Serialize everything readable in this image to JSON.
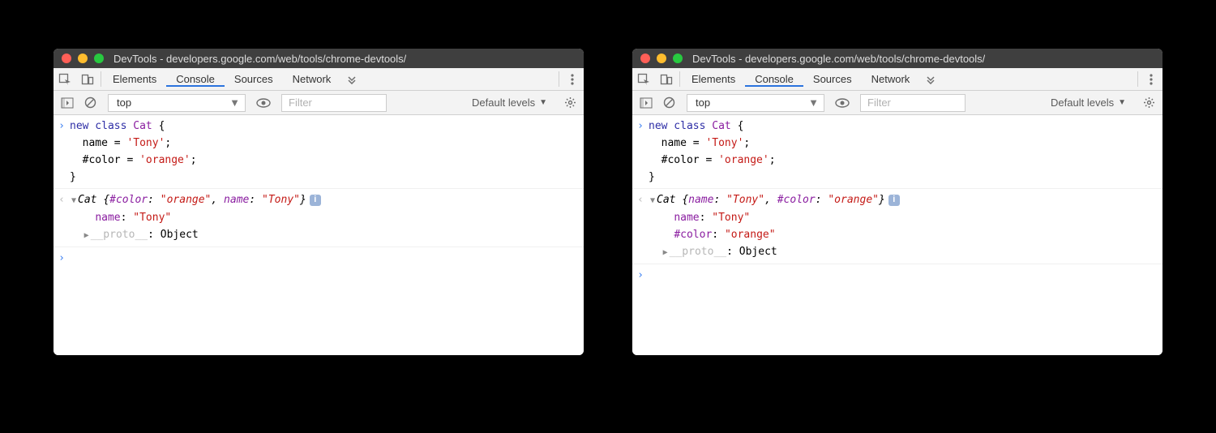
{
  "windows": [
    {
      "title": "DevTools - developers.google.com/web/tools/chrome-devtools/",
      "tabs": [
        "Elements",
        "Console",
        "Sources",
        "Network"
      ],
      "active_tab": "Console",
      "context": "top",
      "filter_placeholder": "Filter",
      "levels_label": "Default levels",
      "input_code": {
        "l1_new": "new",
        "l1_class": " class ",
        "l1_name": "Cat",
        "l1_brace": " {",
        "l2": "  name = ",
        "l2_str": "'Tony'",
        "l2_semi": ";",
        "l3": "  #color = ",
        "l3_str": "'orange'",
        "l3_semi": ";",
        "l4": "}"
      },
      "output": {
        "summary_pre": "Cat ",
        "summary_open": "{",
        "p1_key": "#color",
        "p1_val": "\"orange\"",
        "sep": ", ",
        "p2_key": "name",
        "p2_val": "\"Tony\"",
        "summary_close": "}",
        "lines": [
          {
            "key": "name",
            "val": "\"Tony\"",
            "proto": false
          },
          {
            "key": "__proto__",
            "val": "Object",
            "proto": true
          }
        ]
      }
    },
    {
      "title": "DevTools - developers.google.com/web/tools/chrome-devtools/",
      "tabs": [
        "Elements",
        "Console",
        "Sources",
        "Network"
      ],
      "active_tab": "Console",
      "context": "top",
      "filter_placeholder": "Filter",
      "levels_label": "Default levels",
      "input_code": {
        "l1_new": "new",
        "l1_class": " class ",
        "l1_name": "Cat",
        "l1_brace": " {",
        "l2": "  name = ",
        "l2_str": "'Tony'",
        "l2_semi": ";",
        "l3": "  #color = ",
        "l3_str": "'orange'",
        "l3_semi": ";",
        "l4": "}"
      },
      "output": {
        "summary_pre": "Cat ",
        "summary_open": "{",
        "p1_key": "name",
        "p1_val": "\"Tony\"",
        "sep": ", ",
        "p2_key": "#color",
        "p2_val": "\"orange\"",
        "summary_close": "}",
        "lines": [
          {
            "key": "name",
            "val": "\"Tony\"",
            "proto": false
          },
          {
            "key": "#color",
            "val": "\"orange\"",
            "proto": false
          },
          {
            "key": "__proto__",
            "val": "Object",
            "proto": true
          }
        ]
      }
    }
  ]
}
